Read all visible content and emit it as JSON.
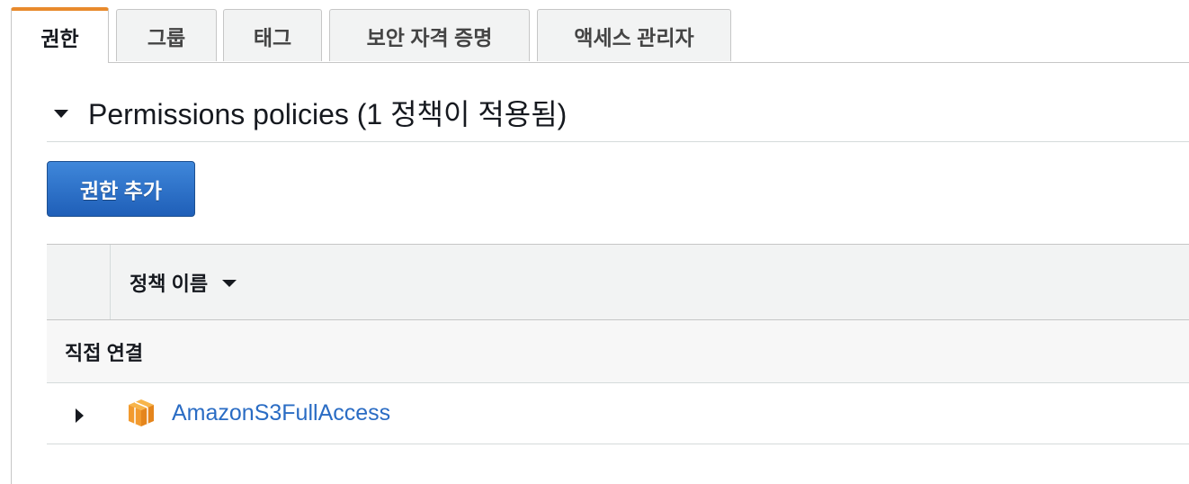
{
  "tabs": [
    {
      "label": "권한",
      "active": true
    },
    {
      "label": "그룹",
      "active": false
    },
    {
      "label": "태그",
      "active": false
    },
    {
      "label": "보안 자격 증명",
      "active": false
    },
    {
      "label": "액세스 관리자",
      "active": false
    }
  ],
  "section": {
    "title": "Permissions policies (1 정책이 적용됨)",
    "icon": "caret-down-icon"
  },
  "add_permission_button": "권한 추가",
  "table": {
    "header": {
      "policy_name": "정책 이름",
      "sort_icon": "caret-down-icon"
    },
    "group_label": "직접 연결",
    "rows": [
      {
        "name": "AmazonS3FullAccess",
        "icon": "aws-managed-policy-box-icon"
      }
    ]
  },
  "colors": {
    "active_tab_accent": "#e88a2c",
    "primary_button": "#2e73c9",
    "link": "#2a6cc4",
    "policy_icon": "#f29a2e"
  }
}
